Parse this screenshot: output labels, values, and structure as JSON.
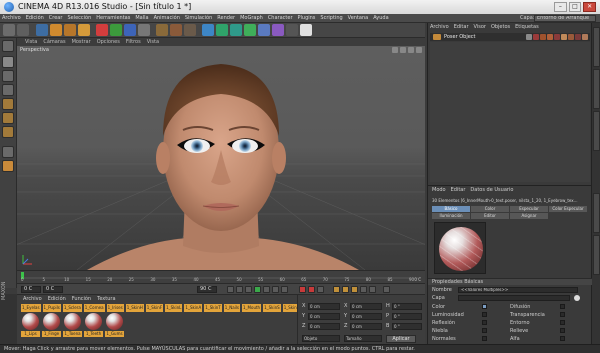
{
  "window": {
    "title": "CINEMA 4D R13.016 Studio - [Sin título 1 *]"
  },
  "menubar": {
    "items": [
      "Archivo",
      "Edición",
      "Crear",
      "Selección",
      "Herramientas",
      "Malla",
      "Animación",
      "Simulación",
      "Render",
      "MoGraph",
      "Character",
      "Plugins",
      "Scripting",
      "Ventana",
      "Ayuda"
    ],
    "layout_label": "Capa:",
    "layout_value": "Entorno de Arranque"
  },
  "viewport": {
    "menu": [
      "Vista",
      "Cámaras",
      "Mostrar",
      "Opciones",
      "Filtros",
      "Vista"
    ],
    "label": "Perspectiva"
  },
  "timeline": {
    "ticks": [
      "0",
      "5",
      "10",
      "15",
      "20",
      "25",
      "30",
      "35",
      "40",
      "45",
      "50",
      "55",
      "60",
      "65",
      "70",
      "75",
      "80",
      "85",
      "90"
    ],
    "end_label": "0 C",
    "start_field": "0 C",
    "current_field": "0 C",
    "end_field": "90 C",
    "max_field": "90 C"
  },
  "materials": {
    "menu": [
      "Archivo",
      "Edición",
      "Función",
      "Textura"
    ],
    "names": [
      "1_Eyelas",
      "1_Pupils",
      "1_Sclera",
      "1_Cornea",
      "1_Irises",
      "1_SkinH",
      "1_SkinF",
      "1_SkinL",
      "1_SkinA",
      "1_SkinT",
      "1_Nails",
      "1_Mouth",
      "1_SkinS",
      "1_SkinN",
      "1_SkinA2"
    ],
    "balls": [
      "1_Lips",
      "1_Finge",
      "1_Toena",
      "1_Teeth",
      "1_Gums"
    ]
  },
  "coords": {
    "rows": [
      {
        "axis": "X",
        "pos": "0 cm",
        "size_axis": "X",
        "size": "0 cm",
        "rot_axis": "H",
        "rot": "0 °"
      },
      {
        "axis": "Y",
        "pos": "0 cm",
        "size_axis": "Y",
        "size": "0 cm",
        "rot_axis": "P",
        "rot": "0 °"
      },
      {
        "axis": "Z",
        "pos": "0 cm",
        "size_axis": "Z",
        "size": "0 cm",
        "rot_axis": "B",
        "rot": "0 °"
      }
    ],
    "mode": "Objeto",
    "size_mode": "Tamaño",
    "apply": "Aplicar"
  },
  "objects": {
    "menu": [
      "Archivo",
      "Editar",
      "Visor",
      "Objetos",
      "Etiquetas"
    ],
    "row_name": "Poser Object"
  },
  "attributes": {
    "menu": [
      "Modo",
      "Editar",
      "Datos de Usuario"
    ],
    "title": "30 Elementos [6_InnerMouth-0_text.poser, nilsta_1_20, 1_Eyebrow_tex...",
    "tabs_row1": [
      "Básico",
      "Color",
      "Especular",
      "Color Especular"
    ],
    "tabs_row2": [
      "Iluminación",
      "Editor",
      "Asignar"
    ],
    "section": "Propiedades Básicas",
    "name_label": "Nombre",
    "name_value": "<<Valores Múltiples>>",
    "layer_label": "Capa",
    "left_channels": [
      "Color",
      "Luminosidad",
      "Reflexión",
      "Niebla",
      "Normales",
      "Especular",
      "Fosforescencia"
    ],
    "right_channels": [
      "Difusión",
      "Transparencia",
      "Entorno",
      "Relieve",
      "Alfa",
      "Color Especular",
      "Desplazamiento"
    ],
    "left_checked": [
      true,
      false,
      false,
      false,
      false,
      true,
      false
    ],
    "right_checked": [
      false,
      false,
      false,
      false,
      false,
      true,
      false
    ]
  },
  "status": {
    "text": "Mover: Haga Click y arrastre para mover elementos. Pulse MAYÚSCULAS para cuantificar el movimiento / añadir a la selección en el modo puntos. CTRL para restar."
  },
  "colors": {
    "accent": "#e3a43a",
    "tab_active": "#6b8fb8",
    "background": "#3b3b3b"
  }
}
